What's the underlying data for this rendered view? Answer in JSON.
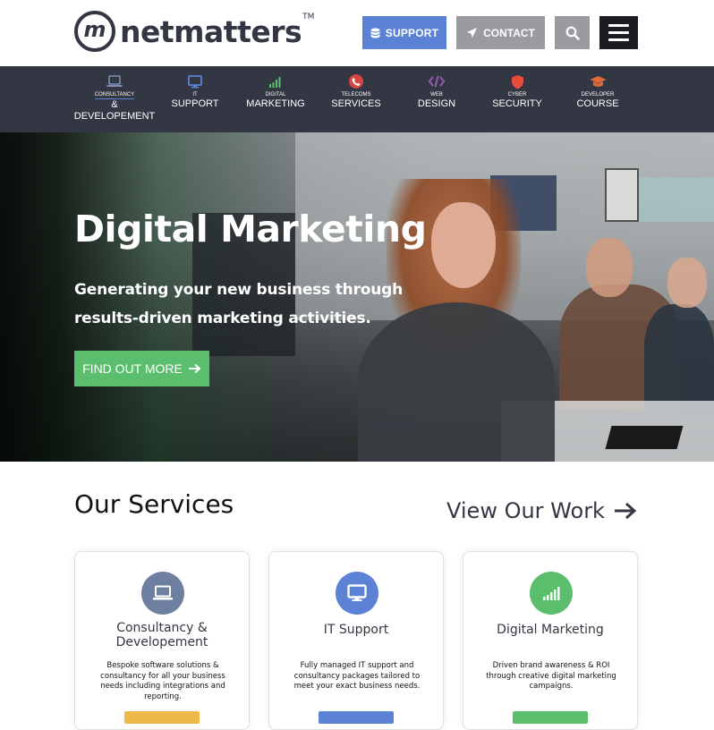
{
  "header": {
    "logo_letter": "m",
    "logo_text": "netmatters",
    "logo_tm": "TM",
    "support_label": "SUPPORT",
    "contact_label": "CONTACT",
    "icons": [
      "database-icon",
      "send-icon",
      "search-icon",
      "hamburger-menu-icon"
    ]
  },
  "nav": {
    "items": [
      {
        "small": "CONSULTANCY",
        "big": "& DEVELOPEMENT",
        "icon": "laptop-icon",
        "color": "#7c8fb5"
      },
      {
        "small": "IT",
        "big": "SUPPORT",
        "icon": "monitor-icon",
        "color": "#5b82d4"
      },
      {
        "small": "DIGITAL",
        "big": "MARKETING",
        "icon": "signal-bars-icon",
        "color": "#5bbe6d"
      },
      {
        "small": "TELECOMS",
        "big": "SERVICES",
        "icon": "phone-icon",
        "color": "#d64541"
      },
      {
        "small": "WEB",
        "big": "DESIGN",
        "icon": "code-icon",
        "color": "#9b59b6"
      },
      {
        "small": "CYBER",
        "big": "SECURITY",
        "icon": "shield-icon",
        "color": "#e74c3c"
      },
      {
        "small": "DEVELOPER",
        "big": "COURSE",
        "icon": "graduation-cap-icon",
        "color": "#e06a3b"
      }
    ]
  },
  "hero": {
    "title": "Digital Marketing",
    "subtitle_line1": "Generating your new business through",
    "subtitle_line2": "results-driven marketing activities.",
    "button_label": "FIND OUT MORE"
  },
  "services": {
    "title": "Our Services",
    "view_work": "View Our Work",
    "cards": [
      {
        "title_line1": "Consultancy &",
        "title_line2": "Developement",
        "text": "Bespoke software solutions & consultancy for all your business needs including integrations and reporting.",
        "color": "#6f7fa0",
        "button_color": "#efb94a",
        "icon": "laptop-icon"
      },
      {
        "title_line1": "IT Support",
        "title_line2": "",
        "text": "Fully managed IT support and consultancy packages tailored to meet your exact business needs.",
        "color": "#5b82d4",
        "button_color": "#5b82d4",
        "icon": "monitor-icon"
      },
      {
        "title_line1": "Digital Marketing",
        "title_line2": "",
        "text": "Driven brand awareness & ROI through creative digital marketing campaigns.",
        "color": "#5bbe6d",
        "button_color": "#5bbe6d",
        "icon": "signal-bars-icon"
      }
    ]
  },
  "colors": {
    "dark": "#333743",
    "support_blue": "#5b82d4",
    "contact_grey": "#999ba1",
    "green": "#5bbe6d"
  }
}
